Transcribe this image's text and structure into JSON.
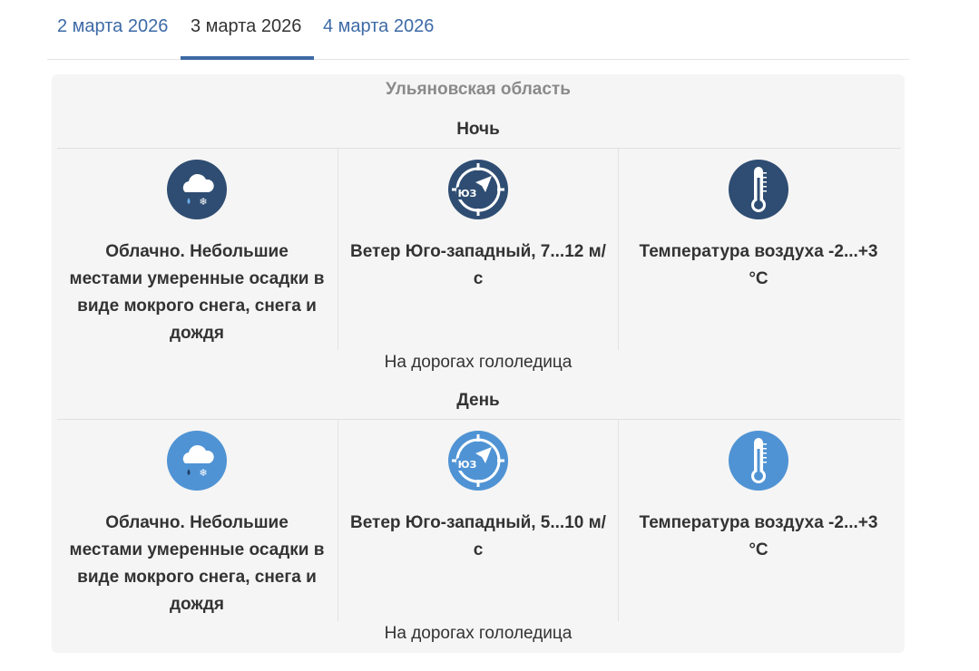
{
  "tabs": [
    {
      "label": "2 марта 2026"
    },
    {
      "label": "3 марта 2026"
    },
    {
      "label": "4 марта 2026"
    }
  ],
  "region": "Ульяновская область",
  "night": {
    "title": "Ночь",
    "weather": "Облачно. Небольшие местами умеренные осадки в виде мокрого снега, снега и дождя",
    "wind": "Ветер Юго-западный, 7...12 м/с",
    "wind_icon_label": "ЮЗ",
    "temp": "Температура воздуха -2...+3 °С",
    "road": "На дорогах гололедица",
    "icon_color": "#2f4d72"
  },
  "day": {
    "title": "День",
    "weather": "Облачно. Небольшие местами умеренные осадки в виде мокрого снега, снега и дождя",
    "wind": "Ветер Юго-западный, 5...10 м/с",
    "wind_icon_label": "ЮЗ",
    "temp": "Температура воздуха -2...+3 °С",
    "road": "На дорогах гололедица",
    "icon_color": "#4f93d4"
  }
}
